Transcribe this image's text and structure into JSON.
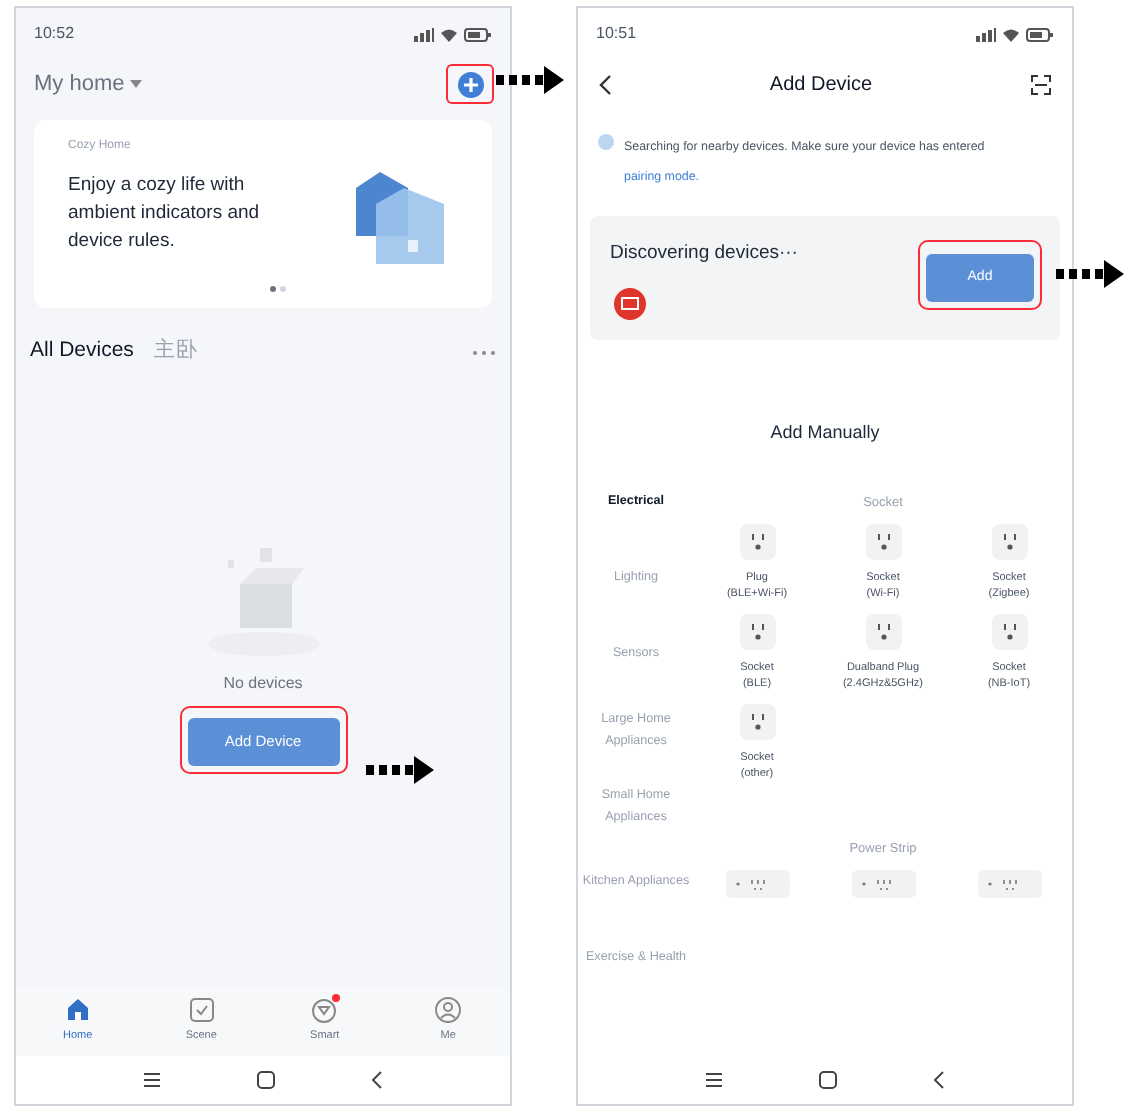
{
  "home_screen": {
    "status_bar": {
      "time": "10:52"
    },
    "home_selector": "My home",
    "add_button": {
      "highlighted": true
    },
    "banner": {
      "tag": "Cozy Home",
      "text": "Enjoy a cozy life with ambient indicators and device rules.",
      "pages": [
        {
          "selected": true
        },
        {
          "selected": false
        }
      ]
    },
    "rooms": [
      {
        "label": "All Devices",
        "selected": true
      },
      {
        "label": "主卧",
        "selected": false
      }
    ],
    "empty_state": {
      "message": "No devices",
      "button": "Add Device",
      "highlighted": true
    },
    "tab_bar": [
      {
        "kind": "home",
        "label": "Home",
        "selected": true,
        "badge": false
      },
      {
        "kind": "scene",
        "label": "Scene",
        "selected": false,
        "badge": false
      },
      {
        "kind": "smart",
        "label": "Smart",
        "selected": false,
        "badge": true
      },
      {
        "kind": "me",
        "label": "Me",
        "selected": false,
        "badge": false
      }
    ]
  },
  "add_device_screen": {
    "status_bar": {
      "time": "10:51"
    },
    "title": "Add Device",
    "notice": {
      "text": "Searching for nearby devices. Make sure your device has entered",
      "link": "pairing mode."
    },
    "discovery": {
      "title": "Discovering devices···",
      "button": "Add",
      "highlighted": true
    },
    "section_title": "Add Manually",
    "categories": [
      {
        "label": "Electrical",
        "selected": true
      },
      {
        "label": "Lighting",
        "selected": false
      },
      {
        "label": "Sensors",
        "selected": false
      },
      {
        "label": "Large Home Appliances",
        "selected": false
      },
      {
        "label": "Small Home Appliances",
        "selected": false
      },
      {
        "label": "Kitchen Appliances",
        "selected": false
      },
      {
        "label": "Exercise & Health",
        "selected": false
      }
    ],
    "groups": [
      {
        "title": "Socket",
        "items": [
          {
            "kind": "socket",
            "label": "Plug\n(BLE+Wi-Fi)"
          },
          {
            "kind": "socket",
            "label": "Socket\n(Wi-Fi)"
          },
          {
            "kind": "socket",
            "label": "Socket\n(Zigbee)"
          },
          {
            "kind": "socket",
            "label": "Socket\n(BLE)"
          },
          {
            "kind": "socket",
            "label": "Dualband Plug\n(2.4GHz&5GHz)"
          },
          {
            "kind": "socket",
            "label": "Socket\n(NB-IoT)"
          },
          {
            "kind": "socket",
            "label": "Socket\n(other)"
          }
        ]
      },
      {
        "title": "Power Strip",
        "items": [
          {
            "kind": "power-strip"
          },
          {
            "kind": "power-strip"
          },
          {
            "kind": "power-strip"
          }
        ]
      }
    ]
  }
}
